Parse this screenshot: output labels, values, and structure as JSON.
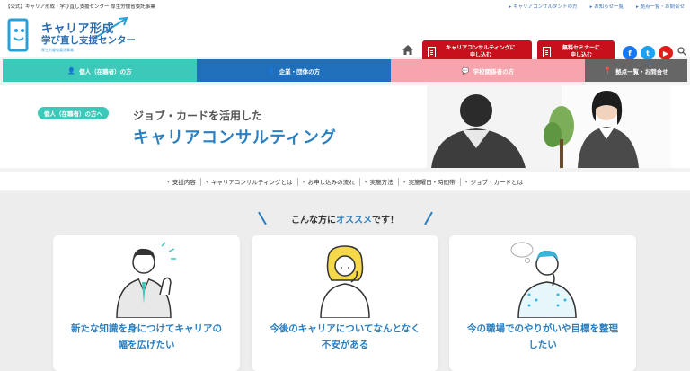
{
  "topbar": {
    "title": "【公式】キャリア形成・学び直し支援センター 厚生労働省委託事業",
    "links": [
      "キャリアコンサルタントの方",
      "お知らせ一覧",
      "拠点一覧・お問合せ"
    ]
  },
  "logo": {
    "line1": "キャリア形成",
    "line2": "学び直し支援センター",
    "sub": "厚生労働省委託事業"
  },
  "header": {
    "cta_consulting": "キャリアコンサルティングに\n申し込む",
    "cta_seminar": "無料セミナーに\n申し込む",
    "facebook": "f",
    "twitter": "t",
    "youtube": "▶"
  },
  "nav": {
    "items": [
      {
        "label": "個人（在職者）の方",
        "color": "#3cc9ba"
      },
      {
        "label": "企業・団体の方",
        "color": "#1f6fba"
      },
      {
        "label": "学校関係者の方",
        "color": "#f6a4ad"
      },
      {
        "label": "拠点一覧・お問合せ",
        "color": "#666666"
      }
    ]
  },
  "hero": {
    "badge": "個人（在職者）の方へ",
    "subtitle": "ジョブ・カードを活用した",
    "title": "キャリアコンサルティング"
  },
  "subnav": {
    "items": [
      "支援内容",
      "キャリアコンサルティングとは",
      "お申し込みの流れ",
      "実施方法",
      "実施曜日・時間帯",
      "ジョブ・カードとは"
    ]
  },
  "section": {
    "title_pre": "こんな方に",
    "title_em": "オススメ",
    "title_post": "です！"
  },
  "cards": [
    {
      "line1": "新たな知識を身につけてキャリアの",
      "line2": "幅を広げたい"
    },
    {
      "line1": "今後のキャリアについてなんとなく",
      "line2": "不安がある"
    },
    {
      "line1": "今の職場でのやりがいや目標を整理",
      "line2": "したい"
    }
  ],
  "colors": {
    "teal": "#3cc9ba",
    "blue": "#1f6fba",
    "pink": "#f6a4ad",
    "gray": "#666666",
    "red": "#c8101d",
    "accent_text": "#2a7fc1"
  }
}
